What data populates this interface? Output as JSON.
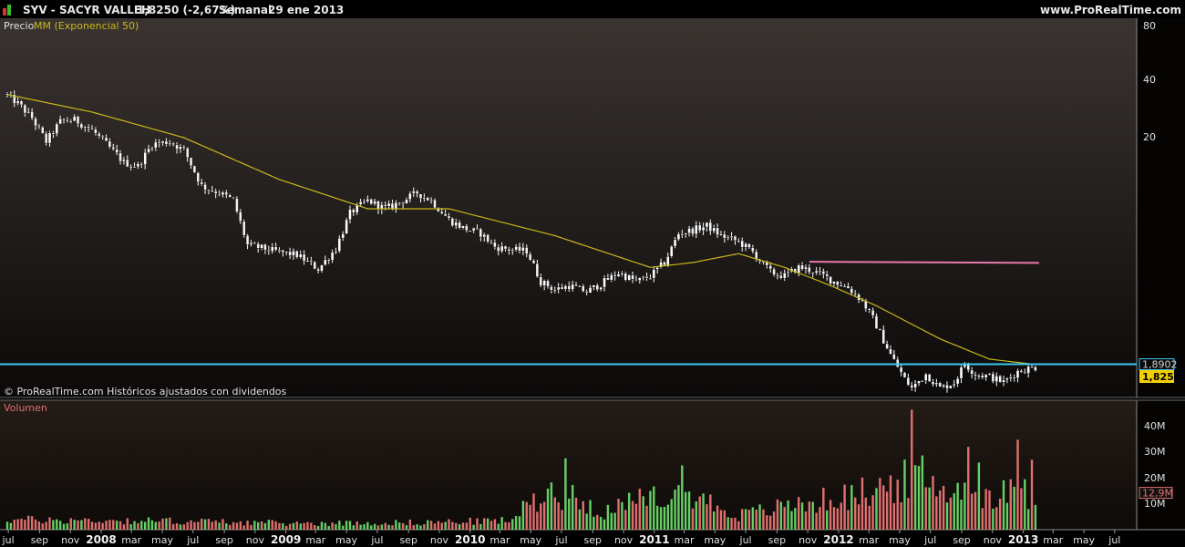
{
  "header": {
    "symbol": "SYV - SACYR VALLEH",
    "price_change": "1,8250 (-2,67%)",
    "timeframe": "Semanal",
    "date": "29 ene 2013",
    "site": "www.ProRealTime.com"
  },
  "colors": {
    "accent_icon_red": "#d93030",
    "accent_icon_green": "#30c030",
    "moving_average": "#c9b818",
    "horizontal_line": "#38c8f0",
    "resistance_line": "#e878b0",
    "volume_up": "#66d066",
    "volume_down": "#e07070",
    "price_tag": "#f5d000"
  },
  "price_panel": {
    "legend_price": "Precio",
    "legend_ma": "MM (Exponencial 50)",
    "credit": "© ProRealTime.com  Históricos ajustados con dividendos",
    "y_ticks": [
      "80",
      "40",
      "20"
    ],
    "hline_label": "1,8902",
    "last_price_label": "1,8250"
  },
  "volume_panel": {
    "legend": "Volumen",
    "y_ticks": [
      "40M",
      "30M",
      "20M",
      "10M"
    ],
    "last_volume_label": "12,9M"
  },
  "x_axis": {
    "labels": [
      "jul",
      "sep",
      "nov",
      "2008",
      "mar",
      "may",
      "jul",
      "sep",
      "nov",
      "2009",
      "mar",
      "may",
      "jul",
      "sep",
      "nov",
      "2010",
      "mar",
      "may",
      "jul",
      "sep",
      "nov",
      "2011",
      "mar",
      "may",
      "jul",
      "sep",
      "nov",
      "2012",
      "mar",
      "may",
      "jul",
      "sep",
      "nov",
      "2013",
      "mar",
      "may",
      "jul"
    ]
  },
  "chart_data": [
    {
      "type": "candlestick",
      "title": "SYV - SACYR VALLEH",
      "scale": "log",
      "ylim": [
        1.35,
        80
      ],
      "y_ticks": [
        80,
        40,
        20
      ],
      "x_range": [
        "2007-06-29",
        "2013-08-01"
      ],
      "price_series_anchors": [
        [
          "2007-06-29",
          36.5
        ],
        [
          "2007-07-20",
          33.5
        ],
        [
          "2007-08-17",
          28.5
        ],
        [
          "2007-09-14",
          22.0
        ],
        [
          "2007-10-12",
          27.5
        ],
        [
          "2007-11-09",
          28.0
        ],
        [
          "2007-12-14",
          25.0
        ],
        [
          "2008-01-18",
          20.5
        ],
        [
          "2008-02-15",
          17.5
        ],
        [
          "2008-03-14",
          16.8
        ],
        [
          "2008-04-11",
          21.5
        ],
        [
          "2008-05-16",
          22.0
        ],
        [
          "2008-06-13",
          20.0
        ],
        [
          "2008-07-18",
          13.5
        ],
        [
          "2008-08-22",
          12.5
        ],
        [
          "2008-09-19",
          11.5
        ],
        [
          "2008-10-17",
          7.0
        ],
        [
          "2008-11-14",
          6.8
        ],
        [
          "2008-12-19",
          6.5
        ],
        [
          "2009-01-23",
          6.3
        ],
        [
          "2009-03-06",
          5.4
        ],
        [
          "2009-04-10",
          6.8
        ],
        [
          "2009-05-08",
          10.0
        ],
        [
          "2009-06-12",
          11.5
        ],
        [
          "2009-07-17",
          10.5
        ],
        [
          "2009-08-21",
          11.5
        ],
        [
          "2009-09-18",
          12.5
        ],
        [
          "2009-10-16",
          11.5
        ],
        [
          "2009-11-20",
          9.3
        ],
        [
          "2009-12-18",
          8.5
        ],
        [
          "2010-01-22",
          8.0
        ],
        [
          "2010-02-19",
          6.9
        ],
        [
          "2010-03-19",
          6.7
        ],
        [
          "2010-04-23",
          6.6
        ],
        [
          "2010-05-21",
          4.7
        ],
        [
          "2010-06-18",
          4.3
        ],
        [
          "2010-07-16",
          4.5
        ],
        [
          "2010-08-20",
          4.2
        ],
        [
          "2010-09-24",
          4.7
        ],
        [
          "2010-10-22",
          5.2
        ],
        [
          "2010-11-26",
          4.7
        ],
        [
          "2010-12-24",
          5.0
        ],
        [
          "2011-01-21",
          5.8
        ],
        [
          "2011-02-18",
          8.0
        ],
        [
          "2011-03-18",
          8.3
        ],
        [
          "2011-04-15",
          8.7
        ],
        [
          "2011-05-13",
          7.8
        ],
        [
          "2011-06-17",
          7.3
        ],
        [
          "2011-07-15",
          6.5
        ],
        [
          "2011-08-19",
          5.2
        ],
        [
          "2011-09-16",
          5.0
        ],
        [
          "2011-10-14",
          5.5
        ],
        [
          "2011-11-11",
          5.3
        ],
        [
          "2011-12-16",
          4.8
        ],
        [
          "2012-01-20",
          4.4
        ],
        [
          "2012-02-17",
          3.8
        ],
        [
          "2012-03-16",
          2.9
        ],
        [
          "2012-04-13",
          2.1
        ],
        [
          "2012-05-11",
          1.6
        ],
        [
          "2012-05-25",
          1.45
        ],
        [
          "2012-06-22",
          1.7
        ],
        [
          "2012-07-20",
          1.45
        ],
        [
          "2012-08-17",
          1.55
        ],
        [
          "2012-09-07",
          1.9
        ],
        [
          "2012-09-28",
          1.7
        ],
        [
          "2012-10-26",
          1.65
        ],
        [
          "2012-11-23",
          1.55
        ],
        [
          "2012-12-21",
          1.75
        ],
        [
          "2013-01-18",
          1.82
        ],
        [
          "2013-01-29",
          1.825
        ]
      ],
      "moving_average": {
        "name": "MM (Exponencial 50)",
        "anchors": [
          [
            "2007-06-29",
            37.0
          ],
          [
            "2007-12-14",
            30.5
          ],
          [
            "2008-06-13",
            23.0
          ],
          [
            "2008-12-19",
            14.5
          ],
          [
            "2009-06-12",
            10.5
          ],
          [
            "2009-11-20",
            10.5
          ],
          [
            "2010-06-18",
            7.8
          ],
          [
            "2010-12-24",
            5.5
          ],
          [
            "2011-03-18",
            5.8
          ],
          [
            "2011-06-17",
            6.4
          ],
          [
            "2011-09-16",
            5.5
          ],
          [
            "2011-12-16",
            4.5
          ],
          [
            "2012-03-16",
            3.6
          ],
          [
            "2012-07-20",
            2.5
          ],
          [
            "2012-10-26",
            2.0
          ],
          [
            "2013-01-29",
            1.88
          ]
        ]
      },
      "horizontal_line": {
        "value": 1.8902,
        "label": "1,8902"
      },
      "resistance_line": {
        "from": "2011-11-04",
        "to": "2013-02-01",
        "value_start": 5.85,
        "value_end": 5.78
      },
      "last_price": 1.825
    },
    {
      "type": "bar",
      "title": "Volumen",
      "ylim": [
        0,
        45
      ],
      "unit": "M",
      "y_ticks": [
        40,
        30,
        20,
        10
      ],
      "volume_anchors_millions": [
        [
          "2007-06-29",
          3.5
        ],
        [
          "2008-06-13",
          3.0
        ],
        [
          "2009-01-23",
          2.2
        ],
        [
          "2009-09-18",
          2.5
        ],
        [
          "2010-03-19",
          3.2
        ],
        [
          "2010-05-21",
          12.0
        ],
        [
          "2010-06-18",
          13.5
        ],
        [
          "2010-09-24",
          6.5
        ],
        [
          "2010-12-24",
          11.0
        ],
        [
          "2011-03-18",
          12.0
        ],
        [
          "2011-06-17",
          5.0
        ],
        [
          "2011-10-14",
          9.0
        ],
        [
          "2012-01-20",
          11.5
        ],
        [
          "2012-05-11",
          17.0
        ],
        [
          "2012-08-17",
          14.0
        ],
        [
          "2012-11-23",
          12.5
        ],
        [
          "2013-01-29",
          12.9
        ]
      ],
      "volume_spikes_millions": [
        [
          "2010-07-09",
          25.0
        ],
        [
          "2011-02-25",
          22.5
        ],
        [
          "2012-05-25",
          42.0
        ],
        [
          "2012-06-15",
          26.0
        ],
        [
          "2012-09-14",
          29.0
        ],
        [
          "2012-10-05",
          23.5
        ],
        [
          "2012-12-21",
          31.5
        ],
        [
          "2013-01-18",
          24.5
        ]
      ],
      "last_volume": 12.9
    }
  ]
}
